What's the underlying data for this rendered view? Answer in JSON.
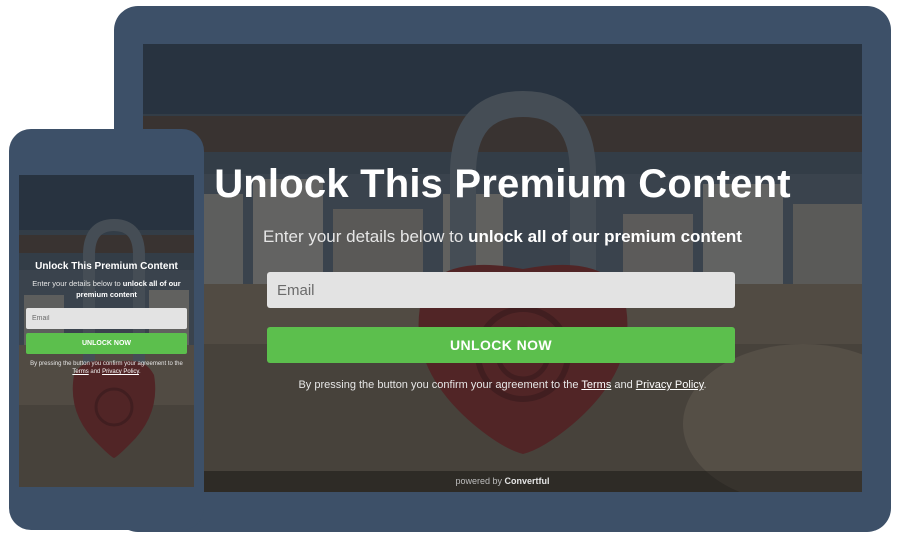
{
  "colors": {
    "device_frame": "#3d5068",
    "button_green": "#5cbf4d",
    "input_bg": "#e3e3e3",
    "overlay": "#1c1e23"
  },
  "images": {
    "background": "love-lock-beach-photo"
  },
  "tablet": {
    "title": "Unlock This Premium Content",
    "subtitle_prefix": "Enter your details below to ",
    "subtitle_bold": "unlock all of our premium content",
    "email_placeholder": "Email",
    "button_label": "UNLOCK NOW",
    "consent_prefix": "By pressing the button you confirm your agreement to the ",
    "terms_link": "Terms",
    "consent_and": " and ",
    "privacy_link": "Privacy Policy",
    "consent_suffix": ".",
    "powered_prefix": "powered by ",
    "powered_brand": "Convertful"
  },
  "phone": {
    "title": "Unlock This Premium Content",
    "subtitle_prefix": "Enter your details below to ",
    "subtitle_bold": "unlock all of our premium content",
    "email_placeholder": "Email",
    "button_label": "UNLOCK NOW",
    "consent_prefix": "By pressing the button you confirm your agreement to the ",
    "terms_link": "Terms",
    "consent_and": " and ",
    "privacy_link": "Privacy Policy",
    "consent_suffix": "."
  }
}
